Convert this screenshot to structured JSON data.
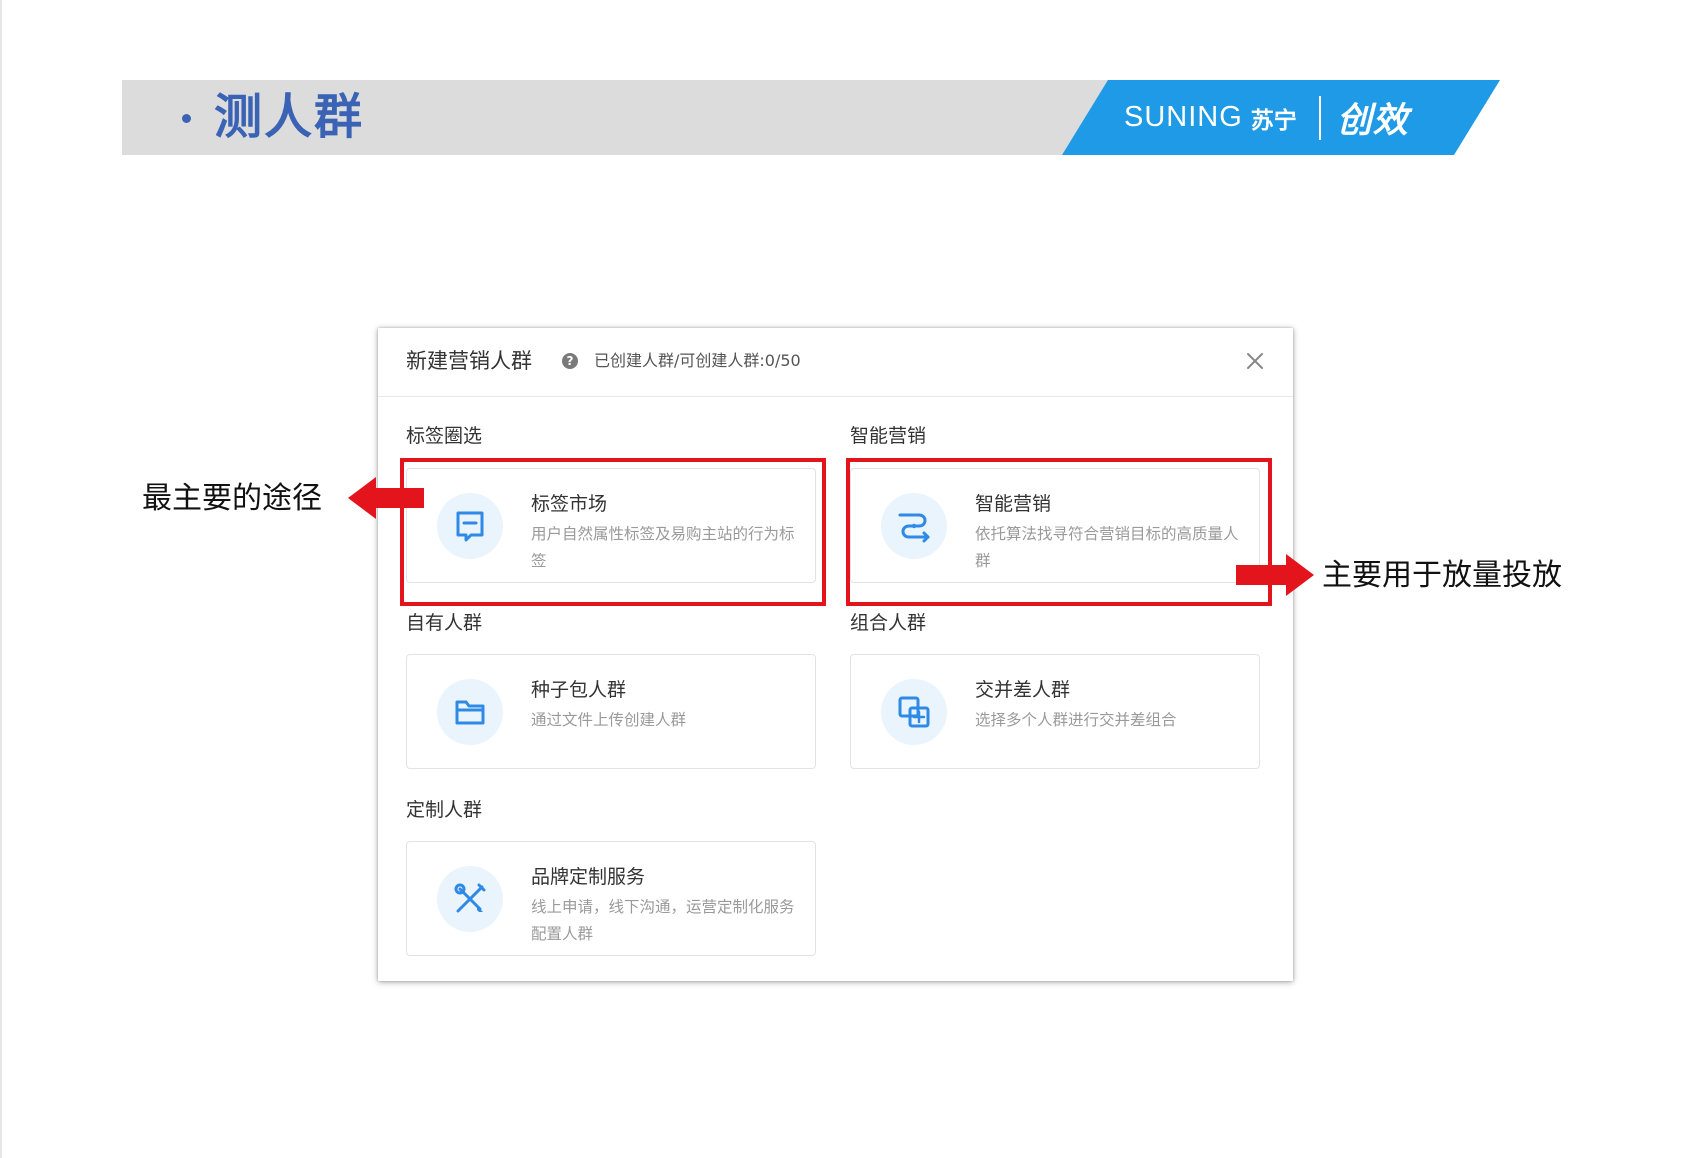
{
  "slide": {
    "title": "测人群",
    "brand_suning": "SUNING",
    "brand_cn": "苏宁",
    "brand_chuangxiao": "创效"
  },
  "dialog": {
    "title": "新建营销人群",
    "count_text": "已创建人群/可创建人群:0/50",
    "sections": [
      {
        "label": "标签圈选",
        "card": {
          "title": "标签市场",
          "desc": "用户自然属性标签及易购主站的行为标签",
          "icon": "tag-document-icon"
        }
      },
      {
        "label": "智能营销",
        "card": {
          "title": "智能营销",
          "desc": "依托算法找寻符合营销目标的高质量人群",
          "icon": "algorithm-flow-icon"
        }
      },
      {
        "label": "自有人群",
        "card": {
          "title": "种子包人群",
          "desc": "通过文件上传创建人群",
          "icon": "folder-icon"
        }
      },
      {
        "label": "组合人群",
        "card": {
          "title": "交并差人群",
          "desc": "选择多个人群进行交并差组合",
          "icon": "combine-squares-icon"
        }
      },
      {
        "label": "定制人群",
        "card": {
          "title": "品牌定制服务",
          "desc": "线上申请，线下沟通，运营定制化服务配置人群",
          "icon": "custom-tools-icon"
        }
      }
    ]
  },
  "annotations": {
    "left": "最主要的途径",
    "right": "主要用于放量投放"
  },
  "colors": {
    "slide_title": "#3a62b5",
    "brand_blue": "#1e9ae6",
    "highlight_red": "#e3141c",
    "icon_blue": "#2f8ae6",
    "icon_bg": "#eaf4fd"
  }
}
